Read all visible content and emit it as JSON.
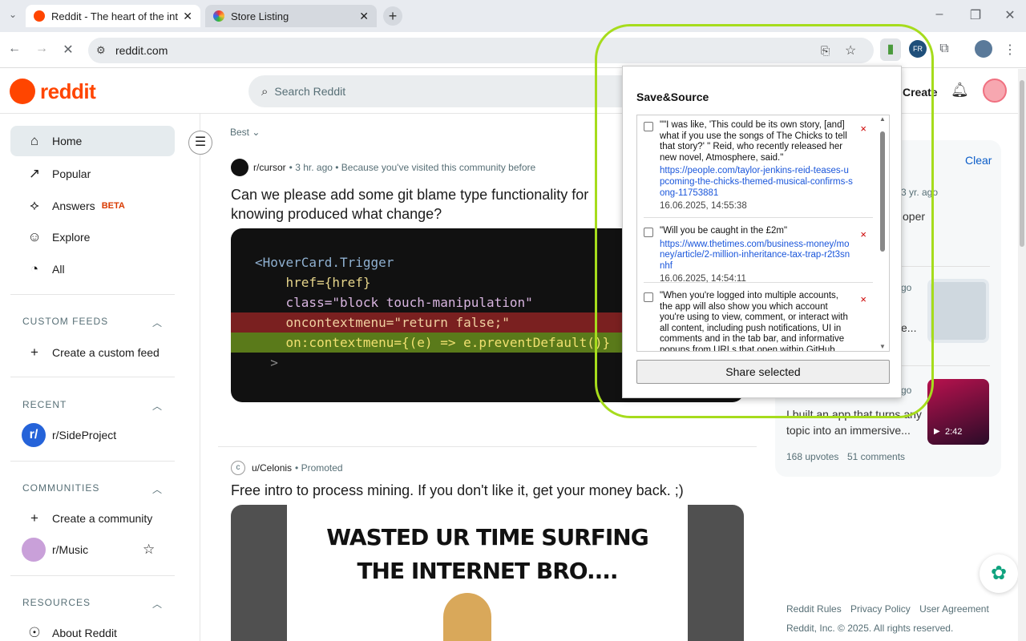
{
  "browser": {
    "tabs": [
      {
        "title": "Reddit - The heart of the internet",
        "active": true
      },
      {
        "title": "Store Listing",
        "active": false
      }
    ],
    "url": "reddit.com"
  },
  "reddit": {
    "logo": "reddit",
    "search_placeholder": "Search Reddit",
    "create_label": "Create",
    "sidebar": {
      "home": "Home",
      "popular": "Popular",
      "answers": "Answers",
      "answers_badge": "BETA",
      "explore": "Explore",
      "all": "All",
      "custom_feeds_head": "CUSTOM FEEDS",
      "create_custom_feed": "Create a custom feed",
      "recent_head": "RECENT",
      "recent_item": "r/SideProject",
      "communities_head": "COMMUNITIES",
      "create_community": "Create a community",
      "community_item": "r/Music",
      "resources_head": "RESOURCES",
      "about": "About Reddit"
    },
    "sort": "Best",
    "post1": {
      "subreddit": "r/cursor",
      "meta": "• 3 hr. ago • Because you've visited this community before",
      "title": "Can we please add some git blame type functionality for knowing produced what change?",
      "code_lines": [
        "<HoverCard.Trigger",
        "    href={href}",
        "    class=\"block touch-manipulation\"",
        "    oncontextmenu=\"return false;\"",
        "    on:contextmenu={(e) => e.preventDefault()}",
        "  >"
      ]
    },
    "post2": {
      "user": "u/Celonis",
      "meta": "• Promoted",
      "title": "Free intro to process mining. If you don't like it, get your money back. ;)",
      "meme_line1": "WASTED UR TIME SURFING",
      "meme_line2": "THE INTERNET BRO...."
    },
    "right": {
      "clear": "Clear",
      "frag1": "3 yr. ago",
      "frag2": "oper",
      "frag3": "go",
      "frag4": "e...",
      "frag5": "go",
      "title_partial": "I built an app that turns any topic into an immersive...",
      "video_len": "2:42",
      "upvotes": "168 upvotes",
      "comments": "51 comments",
      "footer_links": [
        "Reddit Rules",
        "Privacy Policy",
        "User Agreement"
      ],
      "copyright": "Reddit, Inc. © 2025. All rights reserved."
    }
  },
  "popup": {
    "title": "Save&Source",
    "items": [
      {
        "text": "\"\"I was like, 'This could be its own story, [and] what if you use the songs of The Chicks to tell that story?' \" Reid, who recently released her new novel, Atmosphere, said.\"",
        "link": "https://people.com/taylor-jenkins-reid-teases-upcoming-the-chicks-themed-musical-confirms-song-11753881",
        "timestamp": "16.06.2025, 14:55:38"
      },
      {
        "text": "\"Will you be caught in the £2m\"",
        "link": "https://www.thetimes.com/business-money/money/article/2-million-inheritance-tax-trap-r2t3snnhf",
        "timestamp": "16.06.2025, 14:54:11"
      },
      {
        "text": "\"When you're logged into multiple accounts, the app will also show you which account you're using to view, comment, or interact with all content, including push notifications, UI in comments and in the tab bar, and informative popups from URLs that open within GitHub",
        "link": "",
        "timestamp": ""
      }
    ],
    "share_button": "Share selected",
    "delete_glyph": "×"
  },
  "colors": {
    "reddit_orange": "#ff4500",
    "highlight": "#a6dc1c",
    "link": "#1a56db"
  }
}
